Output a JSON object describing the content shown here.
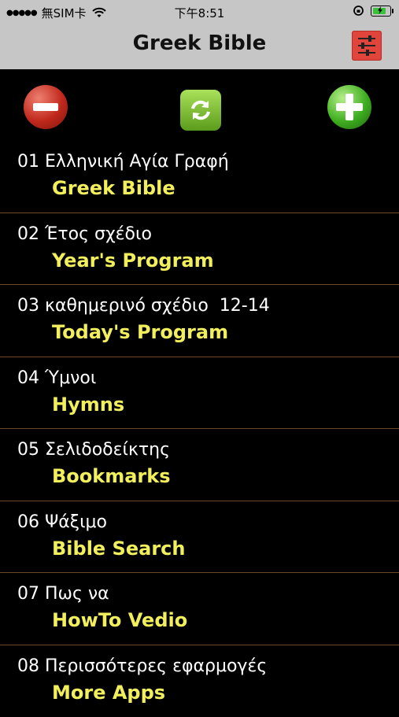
{
  "status_bar": {
    "carrier": "無SIM卡",
    "time": "下午8:51"
  },
  "header": {
    "title": "Greek Bible"
  },
  "menu": [
    {
      "greek": "01 Ελληνική Αγία Γραφή",
      "english": "Greek Bible"
    },
    {
      "greek": "02 Έτος σχέδιο",
      "english": "Year's Program"
    },
    {
      "greek": "03 καθημερινό σχέδιο  12-14",
      "english": "Today's Program"
    },
    {
      "greek": "04 Ύμνοι",
      "english": "Hymns"
    },
    {
      "greek": "05 Σελιδοδείκτης",
      "english": "Bookmarks"
    },
    {
      "greek": "06 Ψάξιμο",
      "english": "Bible Search"
    },
    {
      "greek": "07 Πως να",
      "english": "HowTo Vedio"
    },
    {
      "greek": "08 Περισσότερες εφαρμογές",
      "english": "More Apps"
    }
  ],
  "colors": {
    "header_bg": "#c6c6c6",
    "list_bg": "#000000",
    "primary_text": "#ffffff",
    "secondary_text": "#f2ef5c",
    "divider": "#6a4a2c"
  }
}
